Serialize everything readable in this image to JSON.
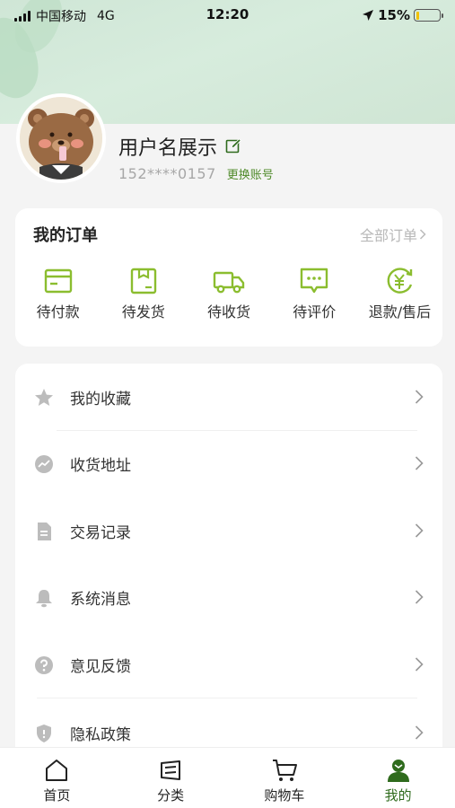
{
  "status_bar": {
    "carrier": "中国移动",
    "network": "4G",
    "time": "12:20",
    "battery": "15%",
    "battery_level": 0.15
  },
  "profile": {
    "username": "用户名展示",
    "phone": "152****0157",
    "switch_account": "更换账号"
  },
  "orders": {
    "title": "我的订单",
    "all_label": "全部订单",
    "items": [
      {
        "label": "待付款",
        "icon": "card-icon"
      },
      {
        "label": "待发货",
        "icon": "box-icon"
      },
      {
        "label": "待收货",
        "icon": "truck-icon"
      },
      {
        "label": "待评价",
        "icon": "comment-icon"
      },
      {
        "label": "退款/售后",
        "icon": "refund-icon"
      }
    ]
  },
  "menu": [
    {
      "label": "我的收藏",
      "icon": "star-icon"
    },
    {
      "label": "收货地址",
      "icon": "location-icon"
    },
    {
      "label": "交易记录",
      "icon": "document-icon"
    },
    {
      "label": "系统消息",
      "icon": "bell-icon"
    },
    {
      "label": "意见反馈",
      "icon": "question-icon"
    },
    {
      "label": "隐私政策",
      "icon": "shield-icon"
    }
  ],
  "tabbar": [
    {
      "label": "首页",
      "icon": "home-icon"
    },
    {
      "label": "分类",
      "icon": "category-icon"
    },
    {
      "label": "购物车",
      "icon": "cart-icon"
    },
    {
      "label": "我的",
      "icon": "profile-icon",
      "active": true
    }
  ],
  "colors": {
    "accent": "#8bbd2f",
    "active_tab": "#2f6b1d",
    "header_bg": "#d3e9d9",
    "link_green": "#4f8a2a"
  }
}
